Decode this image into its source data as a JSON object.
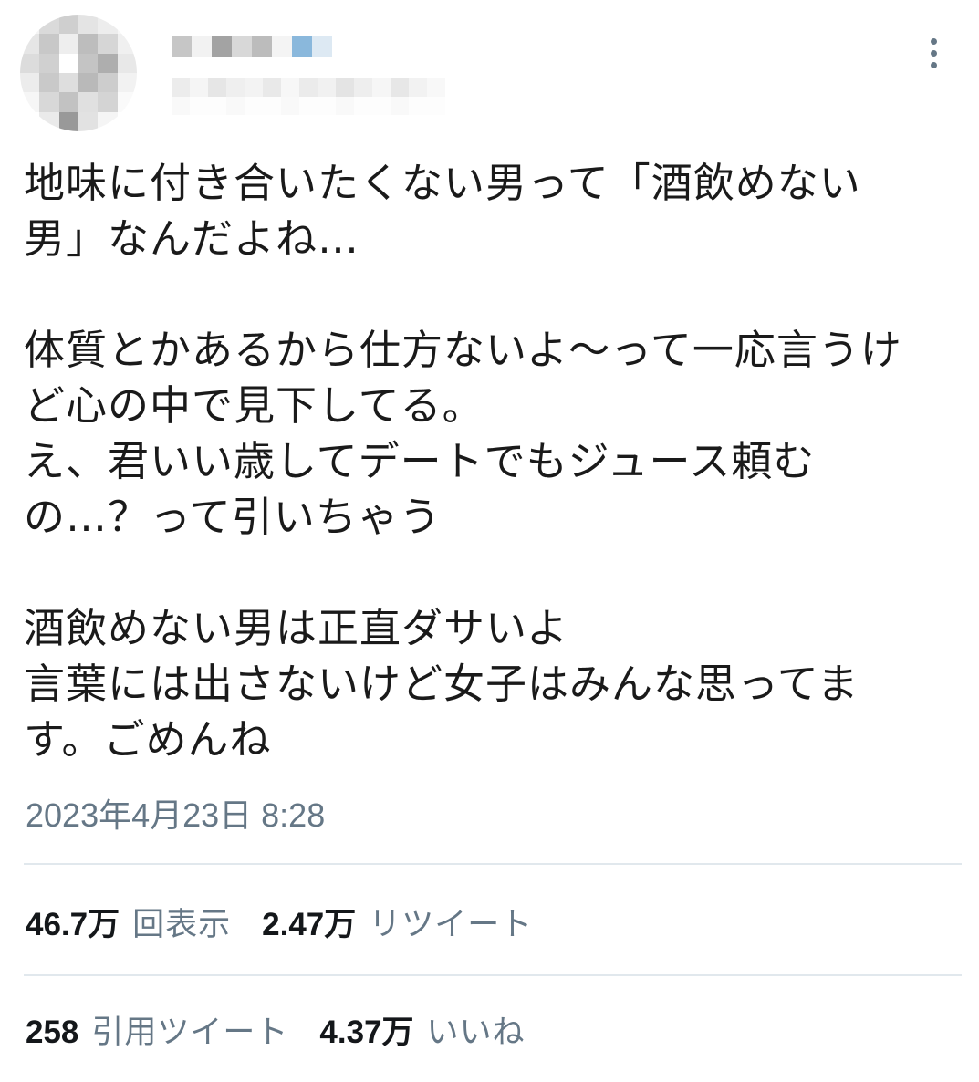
{
  "header": {
    "more_icon": "more-vertical-icon"
  },
  "tweet": {
    "text": "地味に付き合いたくない男って「酒飲めない\n男」なんだよね…\n\n体質とかあるから仕方ないよ〜って一応言うけ\nど心の中で見下してる。\nえ、君いい歳してデートでもジュース頼む\nの…？って引いちゃう\n\n酒飲めない男は正直ダサいよ\n言葉には出さないけど女子はみんな思ってま\nす。ごめんね",
    "timestamp": "2023年4月23日 8:28"
  },
  "stats": {
    "views_count": "46.7万",
    "views_label": "回表示",
    "retweets_count": "2.47万",
    "retweets_label": "リツイート",
    "quotes_count": "258",
    "quotes_label": "引用ツイート",
    "likes_count": "4.37万",
    "likes_label": "いいね"
  },
  "colors": {
    "text": "#14171a",
    "secondary": "#657786",
    "divider": "#e1e8ed",
    "accent": "#8ab8dc"
  }
}
